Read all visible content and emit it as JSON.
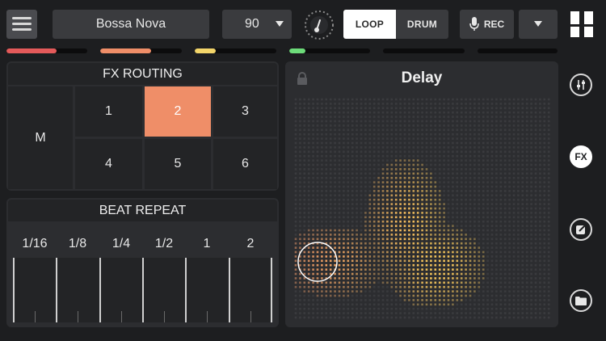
{
  "topbar": {
    "genre": "Bossa Nova",
    "tempo": "90",
    "loop_label": "LOOP",
    "drum_label": "DRUM",
    "rec_label": "REC",
    "mode_selected": "LOOP"
  },
  "levels": [
    {
      "fill": 0.62,
      "color": "#e45a5a"
    },
    {
      "fill": 0.62,
      "color": "#ef8e68"
    },
    {
      "fill": 0.26,
      "color": "#f3d56a"
    },
    {
      "fill": 0.2,
      "color": "#6ddc7a"
    },
    {
      "fill": 0.0,
      "color": "#6ddc7a"
    },
    {
      "fill": 0.0,
      "color": "#6ddc7a"
    }
  ],
  "fx_routing": {
    "title": "FX ROUTING",
    "master_label": "M",
    "slots": [
      "1",
      "2",
      "3",
      "4",
      "5",
      "6"
    ],
    "active_slot": "2",
    "active_color": "#ef8e68"
  },
  "beat_repeat": {
    "title": "BEAT REPEAT",
    "divisions": [
      "1/16",
      "1/8",
      "1/4",
      "1/2",
      "1",
      "2"
    ]
  },
  "fx_pad": {
    "effect_name": "Delay",
    "lock_icon": "lock-icon",
    "dot_color_idle": "#3a3b3e",
    "dot_color_hot": "#f1c25a",
    "dot_color_touch": "#ef8e68"
  },
  "sidebar": {
    "mixer_icon": "sliders-icon",
    "fx_label": "FX",
    "edit_icon": "edit-icon",
    "folder_icon": "folder-icon"
  },
  "colors": {
    "background": "#1d1e20",
    "panel": "#2c2d30",
    "accent": "#ef8e68"
  }
}
